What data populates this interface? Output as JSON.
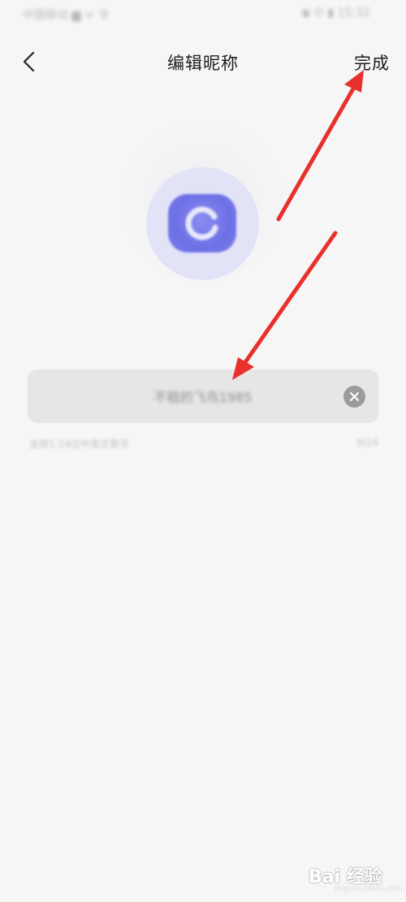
{
  "status_bar": {
    "left_text": "中国移动 ▆ ᯤ 令",
    "right_text": "◉ ✆ ▮ 15:32"
  },
  "nav": {
    "back_icon": "chevron-left-icon",
    "title": "编辑昵称",
    "done_label": "完成"
  },
  "avatar": {
    "logo_icon": "circular-arrow-logo-icon",
    "colors": {
      "ring": "#e3e3f7",
      "logo": "#6d70e6"
    }
  },
  "nickname_field": {
    "value": "不稳的飞鸟1985",
    "clear_icon": "clear-icon"
  },
  "hint": {
    "text": "支持1-24位中英文数字",
    "counter": "9/24"
  },
  "annotation": {
    "color": "#e8302c"
  },
  "watermark": {
    "logo_text": "Bai 经验",
    "url": "jingyan.baidu.com"
  }
}
